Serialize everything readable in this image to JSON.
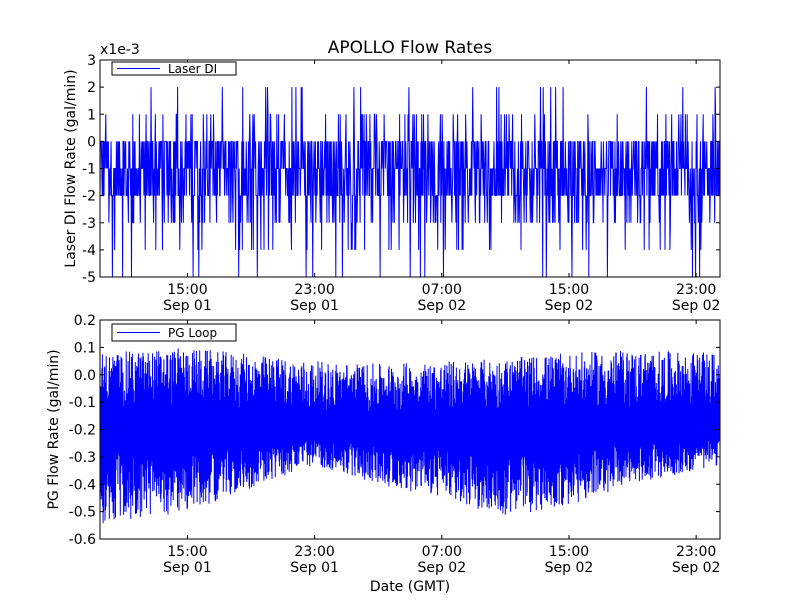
{
  "figure": {
    "title": "APOLLO Flow Rates",
    "xlabel": "Date (GMT)"
  },
  "chart_data": [
    {
      "type": "line",
      "title": "APOLLO Flow Rates",
      "ylabel": "Laser DI Flow Rate (gal/min)",
      "offset_text": "x1e-3",
      "ylim": [
        -5,
        3
      ],
      "yticks": [
        -5,
        -4,
        -3,
        -2,
        -1,
        0,
        1,
        2,
        3
      ],
      "ytick_labels": [
        "-5",
        "-4",
        "-3",
        "-2",
        "-1",
        "0",
        "1",
        "2",
        "3"
      ],
      "xlim": [
        "2013-09-01T09:30",
        "2013-09-03T00:30"
      ],
      "xticks": [
        {
          "t": "2013-09-01T15:00",
          "time": "15:00",
          "date": "Sep 01"
        },
        {
          "t": "2013-09-01T23:00",
          "time": "23:00",
          "date": "Sep 01"
        },
        {
          "t": "2013-09-02T07:00",
          "time": "07:00",
          "date": "Sep 02"
        },
        {
          "t": "2013-09-02T15:00",
          "time": "15:00",
          "date": "Sep 02"
        },
        {
          "t": "2013-09-02T23:00",
          "time": "23:00",
          "date": "Sep 02"
        }
      ],
      "legend_position": "top-left",
      "color": "#0000ff",
      "series": [
        {
          "name": "Laser DI",
          "values_desc": "noisy quantized signal, mostly between -2 and 0 (x1e-3 gal/min), frequent spikes to +1/+2 and dips to -3/-4, occasional drops to -5",
          "typical_min": -2,
          "typical_max": 0,
          "spike_max": 2,
          "dip_min": -5
        }
      ]
    },
    {
      "type": "line",
      "ylabel": "PG Flow Rate (gal/min)",
      "ylim": [
        -0.6,
        0.2
      ],
      "yticks": [
        -0.6,
        -0.5,
        -0.4,
        -0.3,
        -0.2,
        -0.1,
        0.0,
        0.1,
        0.2
      ],
      "ytick_labels": [
        "-0.6",
        "-0.5",
        "-0.4",
        "-0.3",
        "-0.2",
        "-0.1",
        "0.0",
        "0.1",
        "0.2"
      ],
      "xlim": [
        "2013-09-01T09:30",
        "2013-09-03T00:30"
      ],
      "xticks": [
        {
          "t": "2013-09-01T15:00",
          "time": "15:00",
          "date": "Sep 01"
        },
        {
          "t": "2013-09-01T23:00",
          "time": "23:00",
          "date": "Sep 01"
        },
        {
          "t": "2013-09-02T07:00",
          "time": "07:00",
          "date": "Sep 02"
        },
        {
          "t": "2013-09-02T15:00",
          "time": "15:00",
          "date": "Sep 02"
        },
        {
          "t": "2013-09-02T23:00",
          "time": "23:00",
          "date": "Sep 02"
        }
      ],
      "legend_position": "top-left",
      "color": "#0000ff",
      "series": [
        {
          "name": "PG Loop",
          "values_desc": "dense noisy signal centered near -0.2 gal/min, envelope roughly -0.55..0.1, narrower around 23:00 Sep 01 (about -0.35..0.05)",
          "center": -0.2,
          "envelope_low": [
            [
              "2013-09-01T09:30",
              -0.55
            ],
            [
              "2013-09-01T15:00",
              -0.5
            ],
            [
              "2013-09-01T23:00",
              -0.33
            ],
            [
              "2013-09-02T03:00",
              -0.4
            ],
            [
              "2013-09-02T07:00",
              -0.45
            ],
            [
              "2013-09-02T11:00",
              -0.52
            ],
            [
              "2013-09-02T15:00",
              -0.48
            ],
            [
              "2013-09-02T19:00",
              -0.4
            ],
            [
              "2013-09-03T00:30",
              -0.33
            ]
          ],
          "envelope_high": [
            [
              "2013-09-01T09:30",
              0.08
            ],
            [
              "2013-09-01T15:00",
              0.1
            ],
            [
              "2013-09-01T23:00",
              0.05
            ],
            [
              "2013-09-02T03:00",
              0.04
            ],
            [
              "2013-09-02T07:00",
              0.05
            ],
            [
              "2013-09-02T11:00",
              0.06
            ],
            [
              "2013-09-02T15:00",
              0.08
            ],
            [
              "2013-09-02T19:00",
              0.09
            ],
            [
              "2013-09-03T00:30",
              0.08
            ]
          ]
        }
      ]
    }
  ]
}
